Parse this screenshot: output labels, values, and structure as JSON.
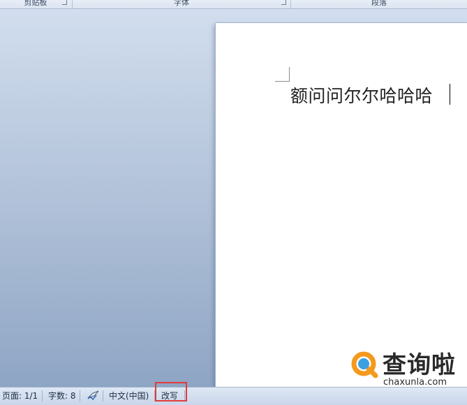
{
  "ribbon": {
    "groups": [
      {
        "label": "剪贴板"
      },
      {
        "label": "字体"
      },
      {
        "label": "段落"
      }
    ]
  },
  "document": {
    "text": "额问问尔尔哈哈哈"
  },
  "statusbar": {
    "page": "页面: 1/1",
    "word_count": "字数: 8",
    "language": "中文(中国)",
    "mode": "改写"
  },
  "watermark": {
    "brand": "查询啦",
    "domain": "chaxunla.com",
    "accent": "#f39a1e"
  },
  "colors": {
    "highlight": "#e23b3b"
  }
}
